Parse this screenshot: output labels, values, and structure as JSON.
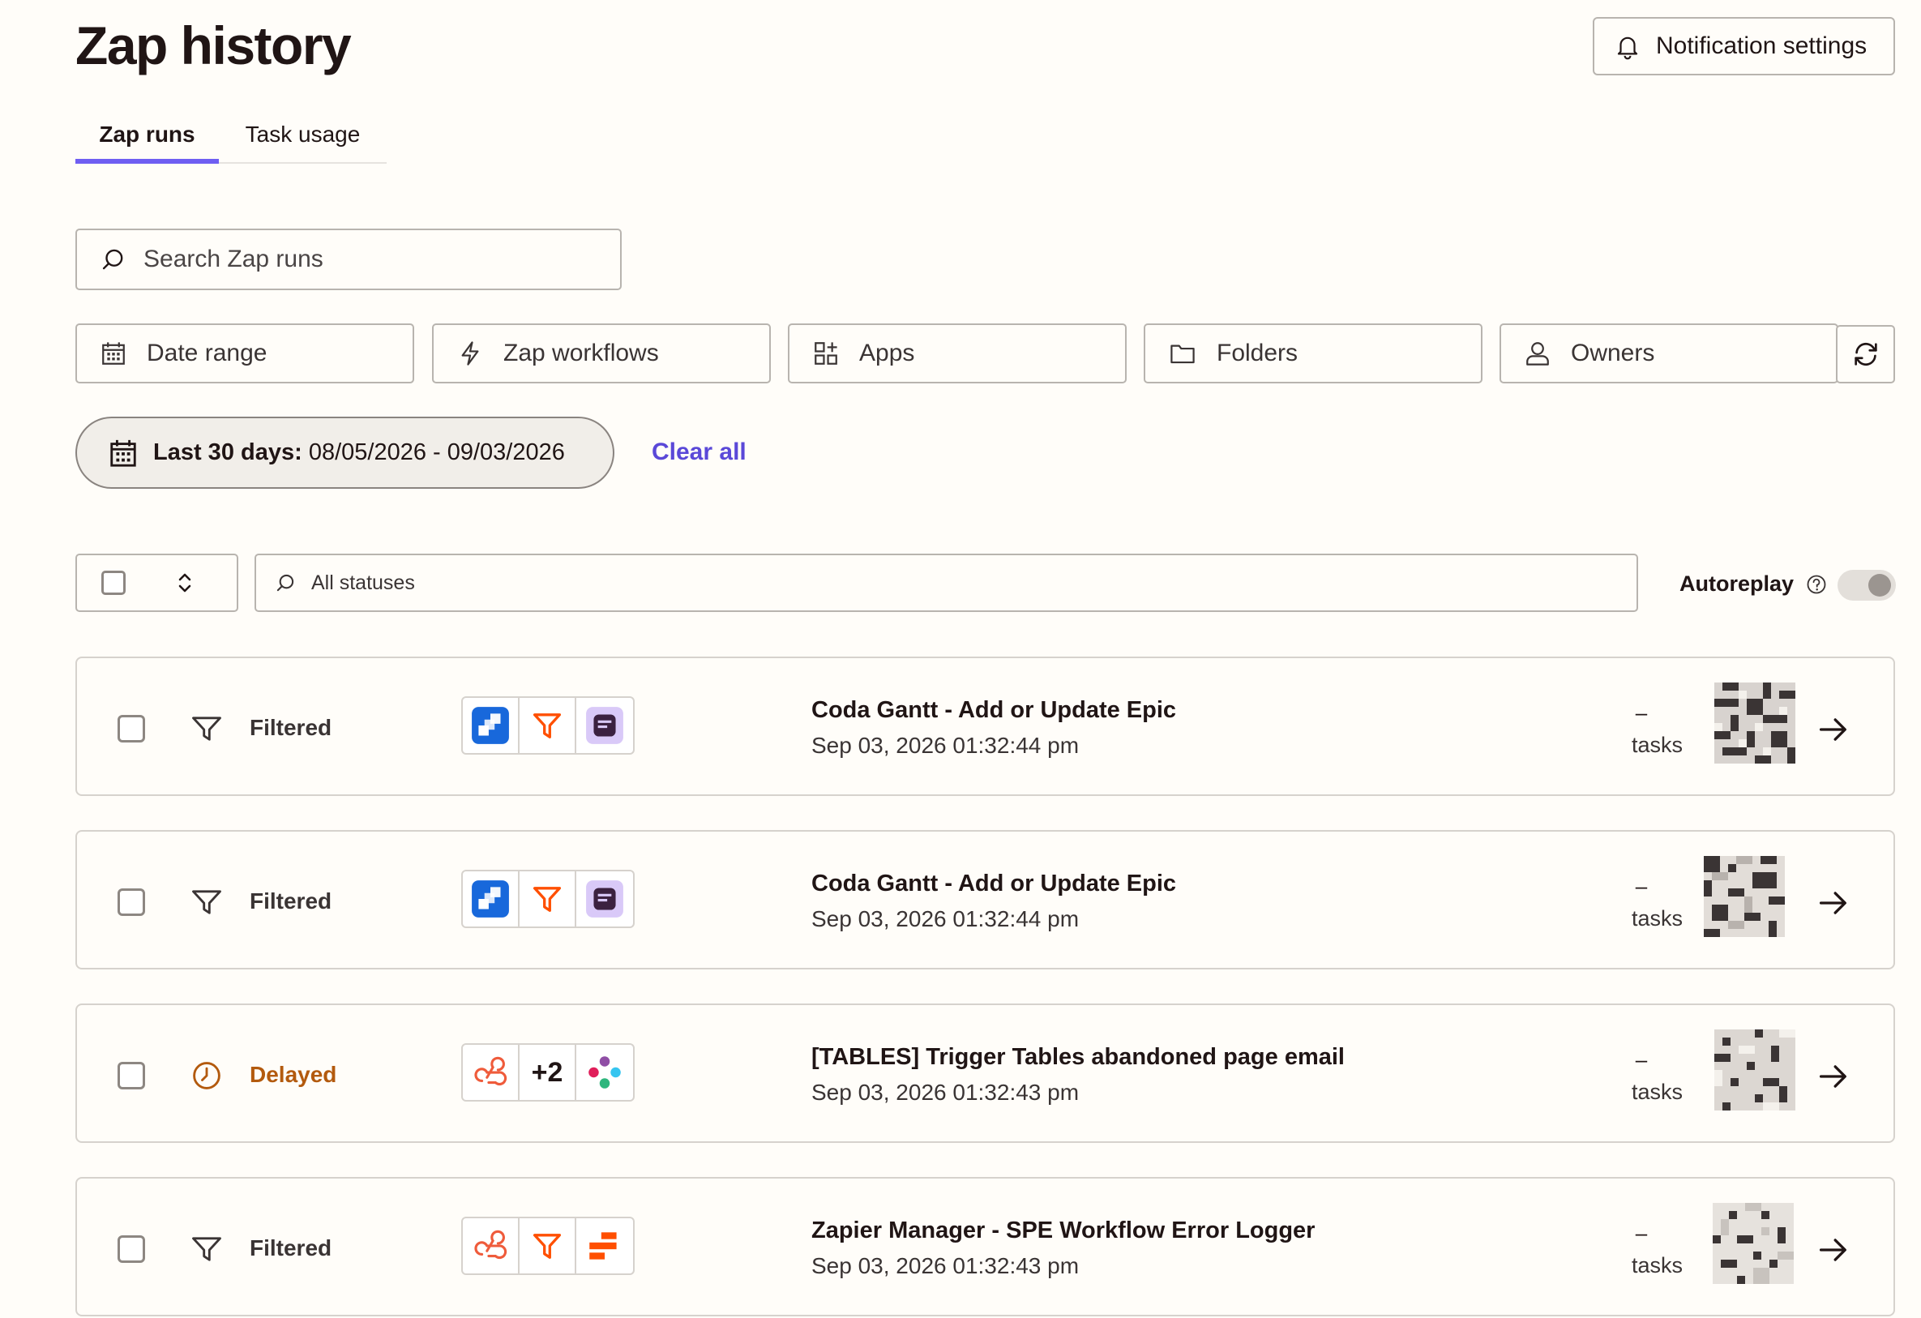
{
  "header": {
    "title": "Zap history",
    "notification_button": "Notification settings"
  },
  "tabs": [
    {
      "label": "Zap runs",
      "active": true
    },
    {
      "label": "Task usage",
      "active": false
    }
  ],
  "search": {
    "placeholder": "Search Zap runs"
  },
  "filters": {
    "date_range": "Date range",
    "zap_workflows": "Zap workflows",
    "apps": "Apps",
    "folders": "Folders",
    "owners": "Owners"
  },
  "active_filter": {
    "label": "Last 30 days:",
    "value": "08/05/2026 - 09/03/2026",
    "clear_all": "Clear all"
  },
  "status_filter": {
    "placeholder": "All statuses"
  },
  "autoreplay": {
    "label": "Autoreplay",
    "enabled": false
  },
  "colors": {
    "accent": "#6f5ef2",
    "link": "#5a48d8",
    "delayed": "#b35a0e",
    "filter_orange": "#ff4f00",
    "jira_blue": "#1868db",
    "coda_lavender": "#d9c9f8"
  },
  "runs": [
    {
      "status": "Filtered",
      "status_icon": "funnel-icon",
      "apps": [
        "jira-icon",
        "filter-icon",
        "coda-icon"
      ],
      "zap_name": "Coda Gantt - Add or Update Epic",
      "timestamp": "Sep 03, 2026 01:32:44 pm",
      "tasks_value": "–",
      "tasks_label": "tasks"
    },
    {
      "status": "Filtered",
      "status_icon": "funnel-icon",
      "apps": [
        "jira-icon",
        "filter-icon",
        "coda-icon"
      ],
      "zap_name": "Coda Gantt - Add or Update Epic",
      "timestamp": "Sep 03, 2026 01:32:44 pm",
      "tasks_value": "–",
      "tasks_label": "tasks"
    },
    {
      "status": "Delayed",
      "status_icon": "clock-icon",
      "apps": [
        "webhook-icon",
        "+2",
        "slack-icon"
      ],
      "zap_name": "[TABLES] Trigger Tables abandoned page email",
      "timestamp": "Sep 03, 2026 01:32:43 pm",
      "tasks_value": "–",
      "tasks_label": "tasks"
    },
    {
      "status": "Filtered",
      "status_icon": "funnel-icon",
      "apps": [
        "webhook-icon",
        "filter-icon",
        "zapier-manager-icon"
      ],
      "zap_name": "Zapier Manager - SPE Workflow Error Logger",
      "timestamp": "Sep 03, 2026 01:32:43 pm",
      "tasks_value": "–",
      "tasks_label": "tasks"
    }
  ]
}
